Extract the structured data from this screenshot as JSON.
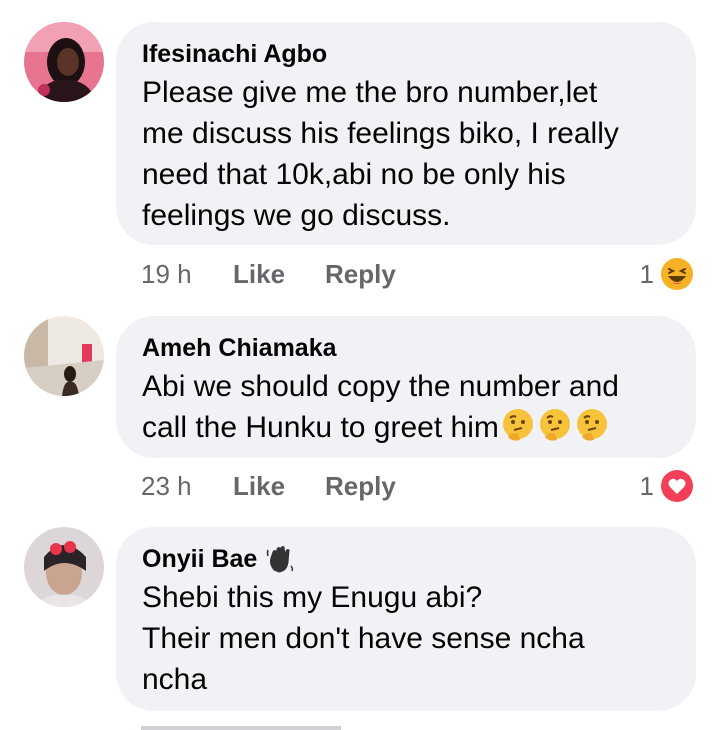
{
  "comments": [
    {
      "author": "Ifesinachi Agbo",
      "text": "Please give me the bro number,let\nme discuss his feelings biko, I really\nneed that 10k,abi no be only his\nfeelings we go discuss.",
      "time": "19 h",
      "like": "Like",
      "reply": "Reply",
      "reaction_count": "1",
      "reaction": "laughing-emoji"
    },
    {
      "author": "Ameh Chiamaka",
      "text_line1": "Abi we should copy the number and",
      "text_line2": "call the Hunku to greet him",
      "time": "23 h",
      "like": "Like",
      "reply": "Reply",
      "reaction_count": "1",
      "reaction": "heart-reaction",
      "emoji_inline": "thinking-face-emoji"
    },
    {
      "author": "Onyii Bae",
      "badge": "waving-hand-emoji",
      "text": "Shebi this my Enugu abi?\nTheir men don't have sense ncha\nncha"
    }
  ],
  "colors": {
    "bubble": "#f0f2f5",
    "meta_text": "#65676b",
    "heart": "#f33e58",
    "laugh": "#f7b125"
  }
}
